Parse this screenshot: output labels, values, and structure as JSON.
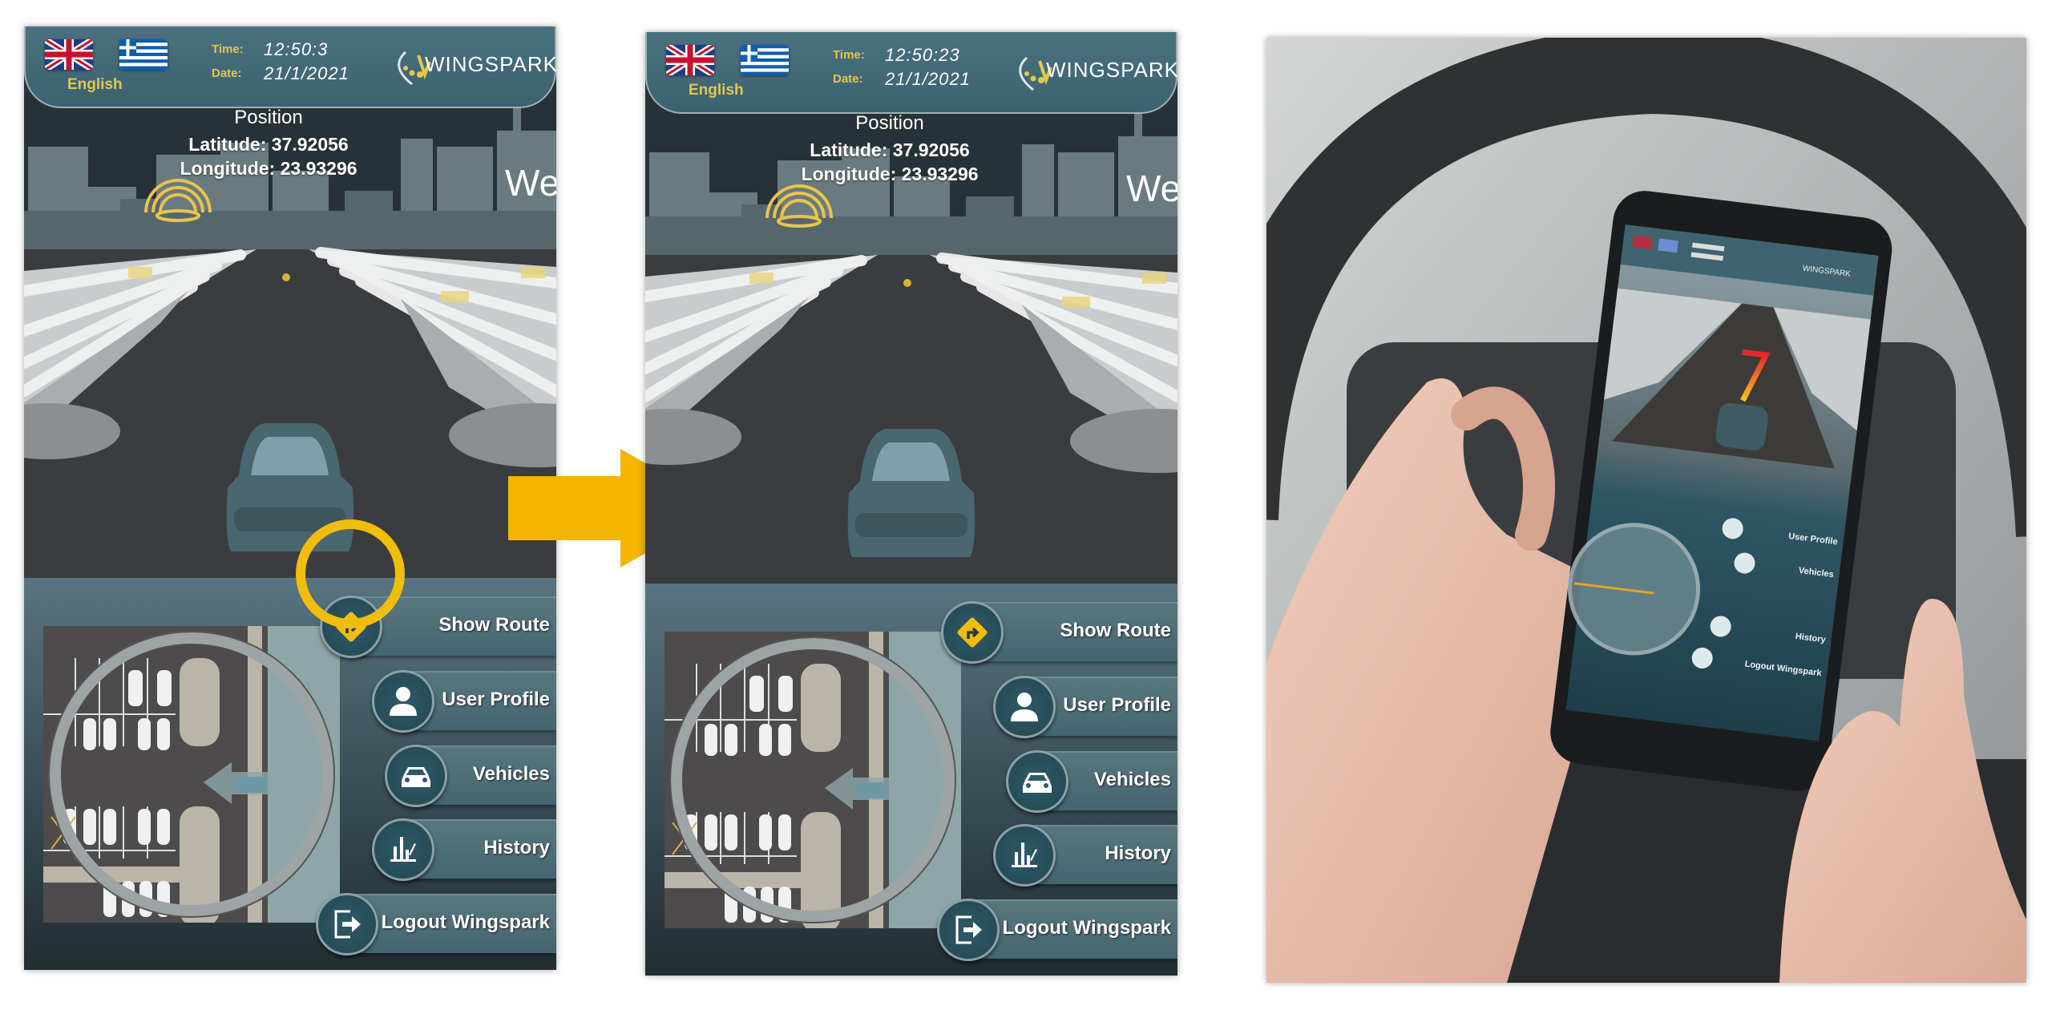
{
  "panels": [
    {
      "header": {
        "language": "English",
        "time_label": "Time:",
        "time": "12:50:3",
        "date_label": "Date:",
        "date": "21/1/2021",
        "logo": "WINGSPARK"
      },
      "position": {
        "title": "Position",
        "latitude": "Latitude: 37.92056",
        "longitude": "Longitude: 23.93296"
      },
      "welcome_partial": "We",
      "menu": [
        {
          "label": "Show Route",
          "icon": "route-sign-icon"
        },
        {
          "label": "User Profile",
          "icon": "user-icon"
        },
        {
          "label": "Vehicles",
          "icon": "car-icon"
        },
        {
          "label": "History",
          "icon": "chart-icon"
        },
        {
          "label": "Logout Wingspark",
          "icon": "logout-icon"
        }
      ],
      "highlighted_item": "Show Route",
      "route_shown": false
    },
    {
      "header": {
        "language": "English",
        "time_label": "Time:",
        "time": "12:50:23",
        "date_label": "Date:",
        "date": "21/1/2021",
        "logo": "WINGSPARK"
      },
      "position": {
        "title": "Position",
        "latitude": "Latitude: 37.92056",
        "longitude": "Longitude: 23.93296"
      },
      "welcome_partial": "We",
      "menu": [
        {
          "label": "Show Route",
          "icon": "route-sign-icon"
        },
        {
          "label": "User Profile",
          "icon": "user-icon"
        },
        {
          "label": "Vehicles",
          "icon": "car-icon"
        },
        {
          "label": "History",
          "icon": "chart-icon"
        },
        {
          "label": "Logout Wingspark",
          "icon": "logout-icon"
        }
      ],
      "highlighted_item": null,
      "route_shown": true
    }
  ],
  "transition_arrow": {
    "icon": "right-arrow-icon",
    "color": "#f4b400"
  },
  "phone_photo": {
    "menu": [
      "User Profile",
      "Vehicles",
      "History",
      "Logout Wingspark"
    ]
  },
  "colors": {
    "header": "#416674",
    "accent": "#f1bd0b",
    "route_start": "#e8262a",
    "route_end": "#f6c51a",
    "menu_bar": "#4d6c76"
  }
}
